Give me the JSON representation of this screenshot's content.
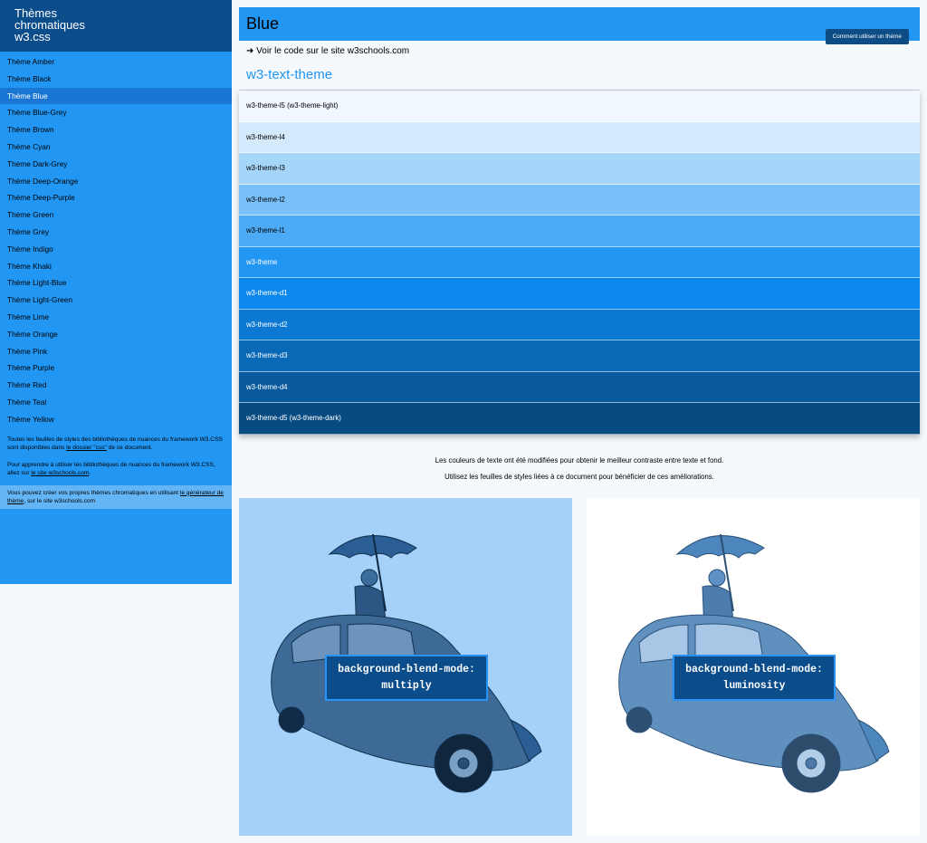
{
  "sidebar": {
    "title": "Thèmes\nchromatiques\nw3.css",
    "items": [
      {
        "label": "Thème Amber",
        "active": false
      },
      {
        "label": "Thème Black",
        "active": false
      },
      {
        "label": "Thème Blue",
        "active": true
      },
      {
        "label": "Thème Blue-Grey",
        "active": false
      },
      {
        "label": "Thème Brown",
        "active": false
      },
      {
        "label": "Thème Cyan",
        "active": false
      },
      {
        "label": "Thème Dark-Grey",
        "active": false
      },
      {
        "label": "Thème Deep-Orange",
        "active": false
      },
      {
        "label": "Thème Deep-Purple",
        "active": false
      },
      {
        "label": "Thème Green",
        "active": false
      },
      {
        "label": "Thème Grey",
        "active": false
      },
      {
        "label": "Thème Indigo",
        "active": false
      },
      {
        "label": "Thème Khaki",
        "active": false
      },
      {
        "label": "Thème Light-Blue",
        "active": false
      },
      {
        "label": "Thème Light-Green",
        "active": false
      },
      {
        "label": "Thème Lime",
        "active": false
      },
      {
        "label": "Thème Orange",
        "active": false
      },
      {
        "label": "Thème Pink",
        "active": false
      },
      {
        "label": "Thème Purple",
        "active": false
      },
      {
        "label": "Thème Red",
        "active": false
      },
      {
        "label": "Thème Teal",
        "active": false
      },
      {
        "label": "Thème Yellow",
        "active": false
      }
    ],
    "note1": {
      "before": "Toutes les feuilles de styles des bibliothèques de nuances du framework W3.CSS sont disponibles dans ",
      "link": "le dossier \"css\"",
      "after": " de ce document."
    },
    "note2": {
      "before": "Pour apprendre à utiliser les bibliothèques de nuances du framework W3.CSS, allez sur ",
      "link": "le site w3schools.com",
      "after": "."
    },
    "note3": {
      "before": "Vous pouvez créer vos propres thèmes chromatiques en utilisant ",
      "link": "le générateur de thème",
      "after": ", sur le site w3schools.com"
    }
  },
  "header": {
    "title": "Blue",
    "button_label": "Comment utiliser un thème"
  },
  "code_link": "➜ Voir le code sur le site w3schools.com",
  "text_theme_heading": "w3-text-theme",
  "shades": [
    {
      "label": "w3-theme-l5 (w3-theme-light)",
      "bg": "#f0f7fe",
      "fg": "#000000"
    },
    {
      "label": "w3-theme-l4",
      "bg": "#d3eafd",
      "fg": "#000000"
    },
    {
      "label": "w3-theme-l3",
      "bg": "#a6d5fa",
      "fg": "#000000"
    },
    {
      "label": "w3-theme-l2",
      "bg": "#79c0f8",
      "fg": "#000000"
    },
    {
      "label": "w3-theme-l1",
      "bg": "#4dabf5",
      "fg": "#000000"
    },
    {
      "label": "w3-theme",
      "bg": "#2196f3",
      "fg": "#ffffff"
    },
    {
      "label": "w3-theme-d1",
      "bg": "#0c87eb",
      "fg": "#ffffff"
    },
    {
      "label": "w3-theme-d2",
      "bg": "#0b78d1",
      "fg": "#ffffff"
    },
    {
      "label": "w3-theme-d3",
      "bg": "#0a69b7",
      "fg": "#ffffff"
    },
    {
      "label": "w3-theme-d4",
      "bg": "#085a9d",
      "fg": "#ffffff"
    },
    {
      "label": "w3-theme-d5 (w3-theme-dark)",
      "bg": "#074b83",
      "fg": "#ffffff"
    }
  ],
  "contrast_notes": [
    "Les couleurs de texte ont été modifiées pour obtenir le meilleur contraste entre texte et fond.",
    "Utilisez les feuilles de styles liées à ce document pour bénéficier de ces améliorations."
  ],
  "blend_panels": [
    {
      "line1": "background-blend-mode:",
      "line2": "multiply"
    },
    {
      "line1": "background-blend-mode:",
      "line2": "luminosity"
    }
  ],
  "colors": {
    "theme": "#2196f3",
    "theme_dark": "#0b4c8a",
    "accent_text": "#2196f3"
  }
}
